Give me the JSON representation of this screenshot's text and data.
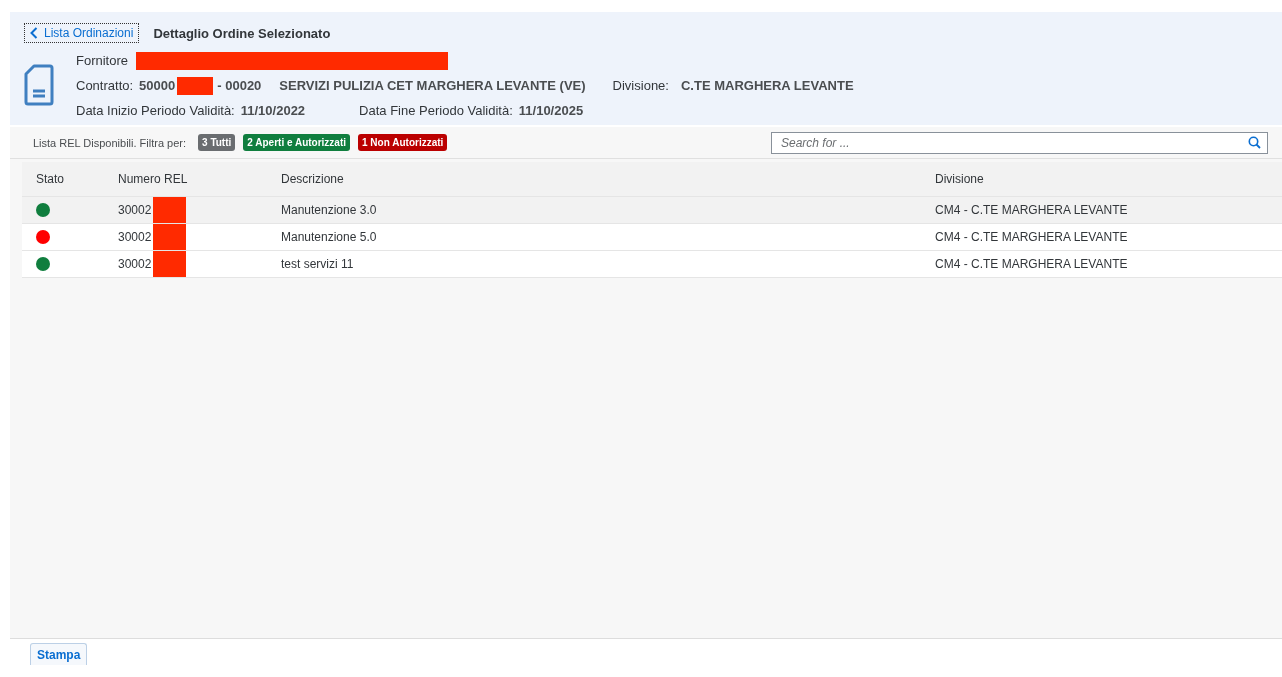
{
  "header": {
    "back_link": "Lista Ordinazioni",
    "title": "Dettaglio Ordine Selezionato",
    "supplier": {
      "label": "Fornitore",
      "redacted": true
    },
    "contract": {
      "label": "Contratto:",
      "number_start": "50000",
      "redacted": true,
      "number_end": "- 00020",
      "description": "SERVIZI PULIZIA CET MARGHERA LEVANTE (VE)",
      "division_label": "Divisione:",
      "division": "C.TE MARGHERA LEVANTE"
    },
    "validity": [
      {
        "label": "Data Inizio Periodo Validità:",
        "value": "11/10/2022"
      },
      {
        "label": "Data Fine Periodo Validità:",
        "value": "11/10/2025"
      }
    ]
  },
  "filter_bar": {
    "label": "Lista REL Disponibili. Filtra per:",
    "chips": [
      {
        "text": "3 Tutti",
        "color": "#6a6d70"
      },
      {
        "text": "2 Aperti e Autorizzati",
        "color": "#107e3e"
      },
      {
        "text": "1 Non Autorizzati",
        "color": "#bb0000"
      }
    ],
    "search": {
      "placeholder": "Search for ..."
    }
  },
  "table": {
    "columns": [
      "Stato",
      "Numero REL",
      "Descrizione",
      "Divisione"
    ],
    "rows": [
      {
        "color": "#107e3e",
        "number": "30002",
        "redacted": true,
        "description": "Manutenzione 3.0",
        "division": "CM4 - C.TE MARGHERA LEVANTE",
        "selected": true
      },
      {
        "color": "#ff0000",
        "number": "30002",
        "redacted": true,
        "description": "Manutenzione 5.0",
        "division": "CM4 - C.TE MARGHERA LEVANTE",
        "selected": false
      },
      {
        "color": "#107e3e",
        "number": "30002",
        "redacted": true,
        "description": "test servizi 11",
        "division": "CM4 - C.TE MARGHERA LEVANTE",
        "selected": false
      }
    ]
  },
  "footer": {
    "buttons": [
      "Stampa"
    ]
  }
}
